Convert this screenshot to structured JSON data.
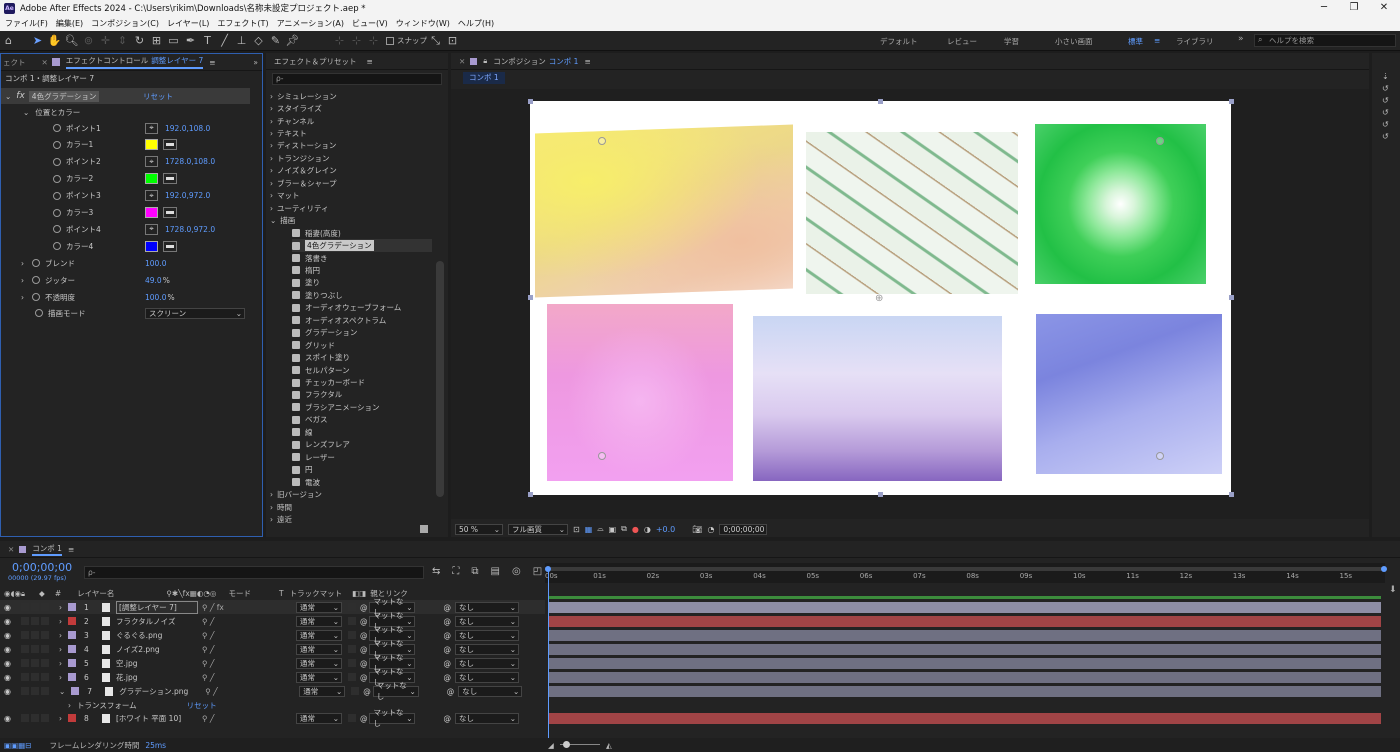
{
  "window": {
    "title": "Adobe After Effects 2024 - C:\\Users\\rikim\\Downloads\\名称未設定プロジェクト.aep *",
    "app_icon": "Ae",
    "minimize": "─",
    "maximize": "❐",
    "close": "✕"
  },
  "menu": [
    "ファイル(F)",
    "編集(E)",
    "コンポジション(C)",
    "レイヤー(L)",
    "エフェクト(T)",
    "アニメーション(A)",
    "ビュー(V)",
    "ウィンドウ(W)",
    "ヘルプ(H)"
  ],
  "toolbar": {
    "snap_label": "スナップ",
    "workspaces": [
      "デフォルト",
      "レビュー",
      "学習",
      "小さい画面",
      "標準",
      "ライブラリ"
    ],
    "active_workspace": "標準",
    "more": "»",
    "help_placeholder": "ヘルプを検索"
  },
  "effect_controls": {
    "tab_prev": "ェクト",
    "tab_label": "エフェクトコントロール",
    "tab_layer": "調整レイヤー 7",
    "layer_path": "コンポ 1・調整レイヤー 7",
    "effect_name": "4色グラデーション",
    "reset": "リセット",
    "group": "位置とカラー",
    "params": [
      {
        "type": "point",
        "label": "ポイント1",
        "value": "192.0,108.0"
      },
      {
        "type": "color",
        "label": "カラー1",
        "color": "#ffff00"
      },
      {
        "type": "point",
        "label": "ポイント2",
        "value": "1728.0,108.0"
      },
      {
        "type": "color",
        "label": "カラー2",
        "color": "#00ff00"
      },
      {
        "type": "point",
        "label": "ポイント3",
        "value": "192.0,972.0"
      },
      {
        "type": "color",
        "label": "カラー3",
        "color": "#ff00ff"
      },
      {
        "type": "point",
        "label": "ポイント4",
        "value": "1728.0,972.0"
      },
      {
        "type": "color",
        "label": "カラー4",
        "color": "#0000ff"
      }
    ],
    "blend_label": "ブレンド",
    "blend_value": "100.0",
    "jitter_label": "ジッター",
    "jitter_value": "49.0",
    "jitter_unit": "%",
    "opacity_label": "不透明度",
    "opacity_value": "100.0",
    "opacity_unit": "%",
    "mode_label": "描画モード",
    "mode_value": "スクリーン"
  },
  "effects_presets": {
    "title": "エフェクト＆プリセット",
    "search_placeholder": "ρ-",
    "categories_before": [
      "シミュレーション",
      "スタイライズ",
      "チャンネル",
      "テキスト",
      "ディストーション",
      "トランジション",
      "ノイズ＆グレイン",
      "ブラー＆シャープ",
      "マット",
      "ユーティリティ"
    ],
    "open_category": "描画",
    "items": [
      "稲妻(高度)",
      "4色グラデーション",
      "落書き",
      "楕円",
      "塗り",
      "塗りつぶし",
      "オーディオウェーブフォーム",
      "オーディオスペクトラム",
      "グラデーション",
      "グリッド",
      "スポイト塗り",
      "セルパターン",
      "チェッカーボード",
      "フラクタル",
      "ブラシアニメーション",
      "ベガス",
      "線",
      "レンズフレア",
      "レーザー",
      "円",
      "電波"
    ],
    "selected_item": "4色グラデーション",
    "categories_after": [
      "旧バージョン",
      "時間",
      "遠近"
    ]
  },
  "composition": {
    "tab_title": "コンポジション",
    "tab_name": "コンポ 1",
    "sub_tab": "コンポ 1",
    "zoom": "50 %",
    "quality": "フル画質",
    "exposure": "+0.0",
    "timecode": "0;00;00;00"
  },
  "timeline": {
    "tab": "コンポ 1",
    "timecode": "0;00;00;00",
    "fps": "00000 (29.97 fps)",
    "search_placeholder": "ρ-",
    "headers": {
      "num": "#",
      "name": "レイヤー名",
      "mode": "モード",
      "t": "T",
      "track_matte": "トラックマット",
      "parent": "親とリンク"
    },
    "layers": [
      {
        "num": "1",
        "name": "[調整レイヤー 7]",
        "label": "#a89ad0",
        "mode": "通常",
        "matte": "マットなし",
        "parent": "なし",
        "bar": "#8e8ea6",
        "selected": true
      },
      {
        "num": "2",
        "name": "フラクタルノイズ",
        "label": "#c23b3b",
        "mode": "通常",
        "matte": "マットなし",
        "parent": "なし",
        "bar": "#a14446"
      },
      {
        "num": "3",
        "name": "ぐるぐる.png",
        "label": "#a89ad0",
        "mode": "通常",
        "matte": "マットなし",
        "parent": "なし",
        "bar": "#6f7082"
      },
      {
        "num": "4",
        "name": "ノイズ2.png",
        "label": "#a89ad0",
        "mode": "通常",
        "matte": "マットなし",
        "parent": "なし",
        "bar": "#6f7082"
      },
      {
        "num": "5",
        "name": "空.jpg",
        "label": "#a89ad0",
        "mode": "通常",
        "matte": "マットなし",
        "parent": "なし",
        "bar": "#6f7082"
      },
      {
        "num": "6",
        "name": "花.jpg",
        "label": "#a89ad0",
        "mode": "通常",
        "matte": "マットなし",
        "parent": "なし",
        "bar": "#6f7082"
      },
      {
        "num": "7",
        "name": "グラデーション.png",
        "label": "#a89ad0",
        "mode": "通常",
        "matte": "マットなし",
        "parent": "なし",
        "bar": "#6f7082"
      }
    ],
    "transform_label": "トランスフォーム",
    "transform_reset": "リセット",
    "layer8": {
      "num": "8",
      "name": "[ホワイト 平面 10]",
      "label": "#c23b3b",
      "mode": "通常",
      "matte": "マットなし",
      "parent": "なし",
      "bar": "#a14446"
    },
    "ruler": [
      "00s",
      "01s",
      "02s",
      "03s",
      "04s",
      "05s",
      "06s",
      "07s",
      "08s",
      "09s",
      "10s",
      "11s",
      "12s",
      "13s",
      "14s",
      "15s"
    ],
    "render_time_label": "フレームレンダリング時間",
    "render_time": "25ms"
  }
}
